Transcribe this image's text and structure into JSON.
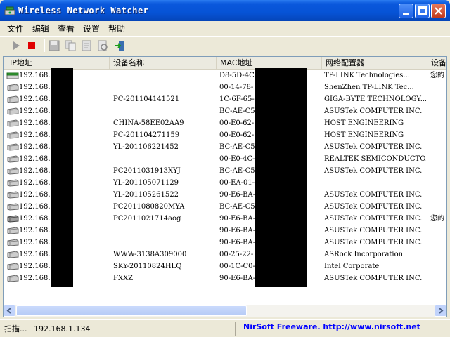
{
  "window": {
    "title": "Wireless Network Watcher"
  },
  "menu": [
    "文件",
    "编辑",
    "查看",
    "设置",
    "帮助"
  ],
  "toolbar": {
    "icons": [
      "play-icon",
      "stop-icon",
      "save-icon",
      "copy-icon",
      "properties-icon",
      "html-report-icon",
      "exit-icon"
    ]
  },
  "columns": [
    "IP地址",
    "设备名称",
    "MAC地址",
    "网络配置器",
    "设备"
  ],
  "rows": [
    {
      "ip": "192.168.",
      "name": "",
      "mac": "D8-5D-4C-",
      "vendor": "TP-LINK Technologies...",
      "extra": "您的",
      "icon": "router"
    },
    {
      "ip": "192.168.",
      "name": "",
      "mac": "00-14-78-",
      "vendor": "ShenZhen TP-LINK Tec...",
      "extra": "",
      "icon": "computer"
    },
    {
      "ip": "192.168.",
      "name": "PC-201104141521",
      "mac": "1C-6F-65-",
      "vendor": "GIGA-BYTE TECHNOLOGY...",
      "extra": "",
      "icon": "computer"
    },
    {
      "ip": "192.168.",
      "name": "",
      "mac": "BC-AE-C5-",
      "vendor": "ASUSTek COMPUTER INC.",
      "extra": "",
      "icon": "computer"
    },
    {
      "ip": "192.168.",
      "name": "CHINA-58EE02AA9",
      "mac": "00-E0-62-",
      "vendor": "HOST ENGINEERING",
      "extra": "",
      "icon": "computer"
    },
    {
      "ip": "192.168.",
      "name": "PC-201104271159",
      "mac": "00-E0-62-",
      "vendor": "HOST ENGINEERING",
      "extra": "",
      "icon": "computer"
    },
    {
      "ip": "192.168.",
      "name": "YL-201106221452",
      "mac": "BC-AE-C5-",
      "vendor": "ASUSTek COMPUTER INC.",
      "extra": "",
      "icon": "computer"
    },
    {
      "ip": "192.168.",
      "name": "",
      "mac": "00-E0-4C-",
      "vendor": "REALTEK SEMICONDUCTO...",
      "extra": "",
      "icon": "computer"
    },
    {
      "ip": "192.168.",
      "name": "PC2011031913XYJ",
      "mac": "BC-AE-C5-",
      "vendor": "ASUSTek COMPUTER INC.",
      "extra": "",
      "icon": "computer"
    },
    {
      "ip": "192.168.",
      "name": "YL-201105071129",
      "mac": "00-EA-01-",
      "vendor": "",
      "extra": "",
      "icon": "computer"
    },
    {
      "ip": "192.168.",
      "name": "YL-201105261522",
      "mac": "90-E6-BA-",
      "vendor": "ASUSTek COMPUTER INC.",
      "extra": "",
      "icon": "computer"
    },
    {
      "ip": "192.168.",
      "name": "PC2011080820MYA",
      "mac": "BC-AE-C5-",
      "vendor": "ASUSTek COMPUTER INC.",
      "extra": "",
      "icon": "computer"
    },
    {
      "ip": "192.168.",
      "name": "PC2011021714aog",
      "mac": "90-E6-BA-",
      "vendor": "ASUSTek COMPUTER INC.",
      "extra": "您的",
      "icon": "computer-dark"
    },
    {
      "ip": "192.168.",
      "name": "",
      "mac": "90-E6-BA-",
      "vendor": "ASUSTek COMPUTER INC.",
      "extra": "",
      "icon": "computer"
    },
    {
      "ip": "192.168.",
      "name": "",
      "mac": "90-E6-BA-",
      "vendor": "ASUSTek COMPUTER INC.",
      "extra": "",
      "icon": "computer"
    },
    {
      "ip": "192.168.",
      "name": "WWW-3138A309000",
      "mac": "00-25-22-",
      "vendor": "ASRock Incorporation",
      "extra": "",
      "icon": "computer"
    },
    {
      "ip": "192.168.",
      "name": "SKY-20110824HLQ",
      "mac": "00-1C-C0-",
      "vendor": "Intel Corporate",
      "extra": "",
      "icon": "computer"
    },
    {
      "ip": "192.168.",
      "name": "FXXZ",
      "mac": "90-E6-BA-",
      "vendor": "ASUSTek COMPUTER INC.",
      "extra": "",
      "icon": "computer"
    }
  ],
  "status": {
    "scan_label": "扫描...",
    "scan_ip": "192.168.1.134",
    "link": "NirSoft Freeware.  http://www.nirsoft.net"
  }
}
